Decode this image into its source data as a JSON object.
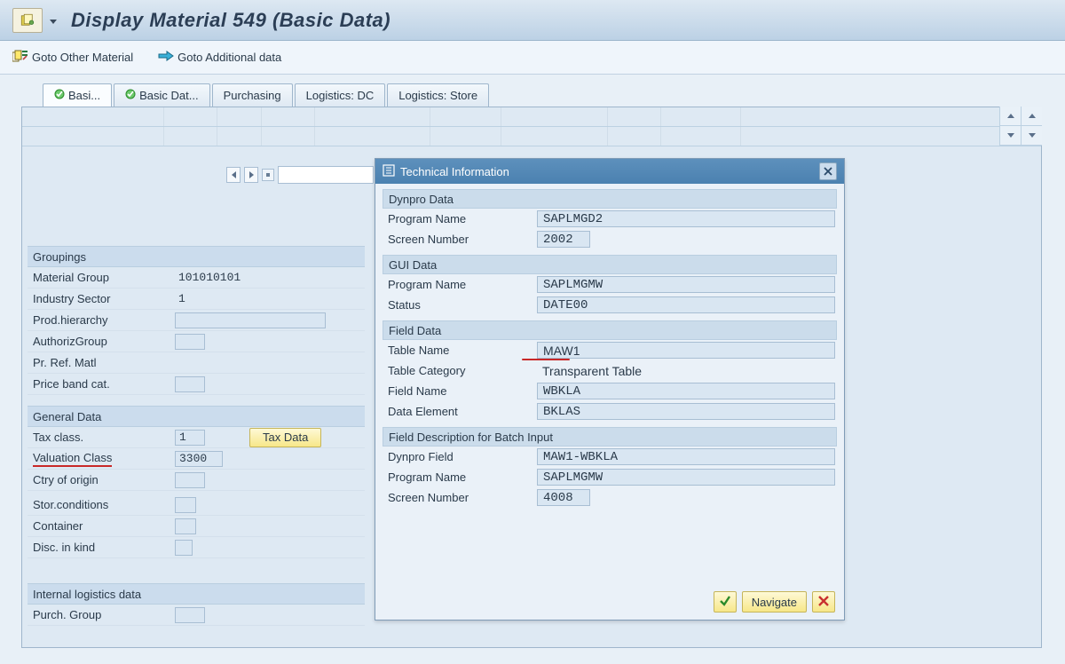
{
  "title": "Display Material 549 (Basic Data)",
  "toolbar": {
    "goto_other": "Goto Other Material",
    "goto_additional": "Goto Additional data"
  },
  "tabs": [
    {
      "label": "Basi...",
      "checked": true
    },
    {
      "label": "Basic Dat...",
      "checked": true
    },
    {
      "label": "Purchasing",
      "checked": false
    },
    {
      "label": "Logistics: DC",
      "checked": false
    },
    {
      "label": "Logistics: Store",
      "checked": false
    }
  ],
  "groupings": {
    "title": "Groupings",
    "fields": {
      "material_group": {
        "label": "Material Group",
        "value": "101010101"
      },
      "industry_sector": {
        "label": "Industry Sector",
        "value": "1"
      },
      "prod_hierarchy": {
        "label": "Prod.hierarchy",
        "value": ""
      },
      "authoriz_group": {
        "label": "AuthorizGroup",
        "value": ""
      },
      "pr_ref_matl": {
        "label": "Pr. Ref. Matl",
        "value": ""
      },
      "price_band_cat": {
        "label": "Price band cat.",
        "value": ""
      }
    }
  },
  "general_data": {
    "title": "General Data",
    "tax_class": {
      "label": "Tax class.",
      "value": "1"
    },
    "tax_data_btn": "Tax Data",
    "valuation_class": {
      "label": "Valuation Class",
      "value": "3300"
    },
    "ctry_of_origin": {
      "label": "Ctry of origin",
      "value": ""
    },
    "stor_conditions": {
      "label": "Stor.conditions",
      "value": ""
    },
    "container": {
      "label": "Container",
      "value": ""
    },
    "disc_in_kind": {
      "label": "Disc. in kind",
      "value": ""
    }
  },
  "internal_logistics": {
    "title": "Internal logistics data",
    "purch_group": {
      "label": "Purch. Group",
      "value": ""
    }
  },
  "dialog": {
    "title": "Technical Information",
    "dynpro_data": {
      "title": "Dynpro Data",
      "program_name": {
        "label": "Program Name",
        "value": "SAPLMGD2"
      },
      "screen_number": {
        "label": "Screen Number",
        "value": "2002"
      }
    },
    "gui_data": {
      "title": "GUI Data",
      "program_name": {
        "label": "Program Name",
        "value": "SAPLMGMW"
      },
      "status": {
        "label": "Status",
        "value": "DATE00"
      }
    },
    "field_data": {
      "title": "Field Data",
      "table_name": {
        "label": "Table Name",
        "value": "MAW1"
      },
      "table_category": {
        "label": "Table Category",
        "value": "Transparent Table"
      },
      "field_name": {
        "label": "Field Name",
        "value": "WBKLA"
      },
      "data_element": {
        "label": "Data Element",
        "value": "BKLAS"
      }
    },
    "batch_input": {
      "title": "Field Description for Batch Input",
      "dynpro_field": {
        "label": "Dynpro Field",
        "value": "MAW1-WBKLA"
      },
      "program_name": {
        "label": "Program Name",
        "value": "SAPLMGMW"
      },
      "screen_number": {
        "label": "Screen Number",
        "value": "4008"
      }
    },
    "navigate_btn": "Navigate"
  }
}
